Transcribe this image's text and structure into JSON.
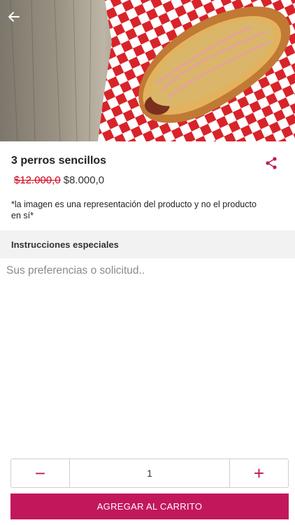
{
  "header": {
    "back_icon": "arrow-left-icon"
  },
  "product": {
    "name": "3 perros sencillos",
    "price_original": "$12.000,0",
    "price_current": "$8.000,0",
    "disclaimer": "*la imagen es una representación del producto y no el producto en sí*",
    "share_icon": "share-icon"
  },
  "instructions": {
    "header": "Instrucciones especiales",
    "placeholder": "Sus preferencias o solicitud.."
  },
  "quantity": {
    "value": "1",
    "decrement_label": "−",
    "increment_label": "+"
  },
  "cart": {
    "add_label": "AGREGAR AL CARRITO"
  },
  "colors": {
    "accent": "#c2185b",
    "strike_price": "#d0021b",
    "section_bg": "#f2f2f2"
  }
}
